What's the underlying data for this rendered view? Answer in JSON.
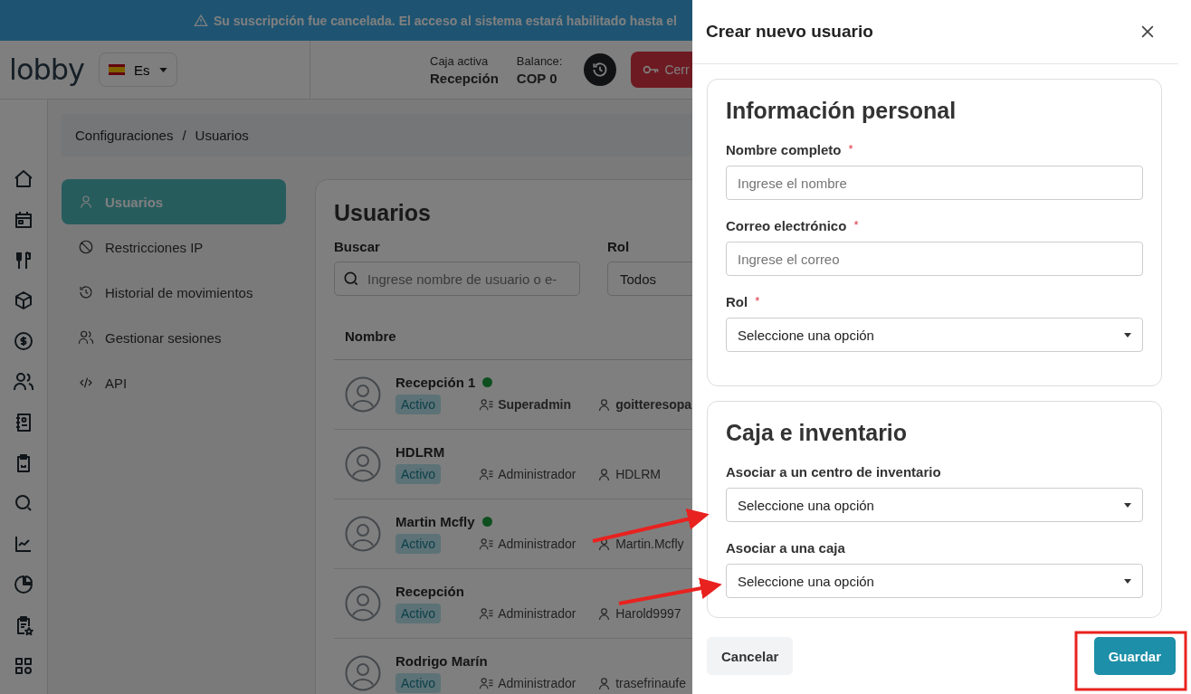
{
  "banner": {
    "text": "Su suscripción fue cancelada. El acceso al sistema estará habilitado hasta el"
  },
  "header": {
    "logo": "lobby",
    "language": "Es",
    "active_register_label": "Caja activa",
    "active_register": "Recepción",
    "balance_label": "Balance:",
    "balance": "COP 0",
    "close_register": "Cerr"
  },
  "rail_icons": [
    {
      "kind": "home"
    },
    {
      "kind": "calendar"
    },
    {
      "kind": "utensils"
    },
    {
      "kind": "box"
    },
    {
      "kind": "dollar"
    },
    {
      "kind": "users"
    },
    {
      "kind": "contacts"
    },
    {
      "kind": "clipboard-chart"
    },
    {
      "kind": "search"
    },
    {
      "kind": "line-chart"
    },
    {
      "kind": "pie"
    },
    {
      "kind": "clipboard-star"
    },
    {
      "kind": "grid"
    }
  ],
  "breadcrumb": {
    "items": [
      "Configuraciones",
      "Usuarios"
    ],
    "separator": "/"
  },
  "settings_nav": [
    {
      "label": "Usuarios",
      "kind": "user",
      "selected": true
    },
    {
      "label": "Restricciones IP",
      "kind": "ban",
      "selected": false
    },
    {
      "label": "Historial de movimientos",
      "kind": "history",
      "selected": false
    },
    {
      "label": "Gestionar sesiones",
      "kind": "users",
      "selected": false
    },
    {
      "label": "API",
      "kind": "code",
      "selected": false
    }
  ],
  "users_panel": {
    "title": "Usuarios",
    "search_label": "Buscar",
    "search_placeholder": "Ingrese nombre de usuario o e-",
    "role_label": "Rol",
    "role_value": "Todos",
    "column": "Nombre",
    "rows": [
      {
        "name": "Recepción 1",
        "online": true,
        "status": "Activo",
        "role": "Superadmin",
        "username": "goitteresopa"
      },
      {
        "name": "HDLRM",
        "online": false,
        "status": "Activo",
        "role": "Administrador",
        "username": "HDLRM"
      },
      {
        "name": "Martin Mcfly",
        "online": true,
        "status": "Activo",
        "role": "Administrador",
        "username": "Martin.Mcfly"
      },
      {
        "name": "Recepción",
        "online": false,
        "status": "Activo",
        "role": "Administrador",
        "username": "Harold9997"
      },
      {
        "name": "Rodrigo Marín",
        "online": false,
        "status": "Activo",
        "role": "Administrador",
        "username": "trasefrinaufe"
      }
    ]
  },
  "drawer": {
    "title": "Crear nuevo usuario",
    "required_mark": "*",
    "sections": [
      {
        "title": "Información personal",
        "fields": [
          {
            "label": "Nombre completo",
            "required": true,
            "kind": "text",
            "placeholder": "Ingrese el nombre"
          },
          {
            "label": "Correo electrónico",
            "required": true,
            "kind": "text",
            "placeholder": "Ingrese el correo"
          },
          {
            "label": "Rol",
            "required": true,
            "kind": "select",
            "value": "Seleccione una opción"
          }
        ]
      },
      {
        "title": "Caja e inventario",
        "fields": [
          {
            "label": "Asociar a un centro de inventario",
            "required": false,
            "kind": "select",
            "value": "Seleccione una opción"
          },
          {
            "label": "Asociar a una caja",
            "required": false,
            "kind": "select",
            "value": "Seleccione una opción"
          }
        ]
      }
    ],
    "buttons": [
      {
        "label": "Cancelar",
        "kind": "secondary"
      },
      {
        "label": "Guardar",
        "kind": "primary"
      }
    ]
  }
}
